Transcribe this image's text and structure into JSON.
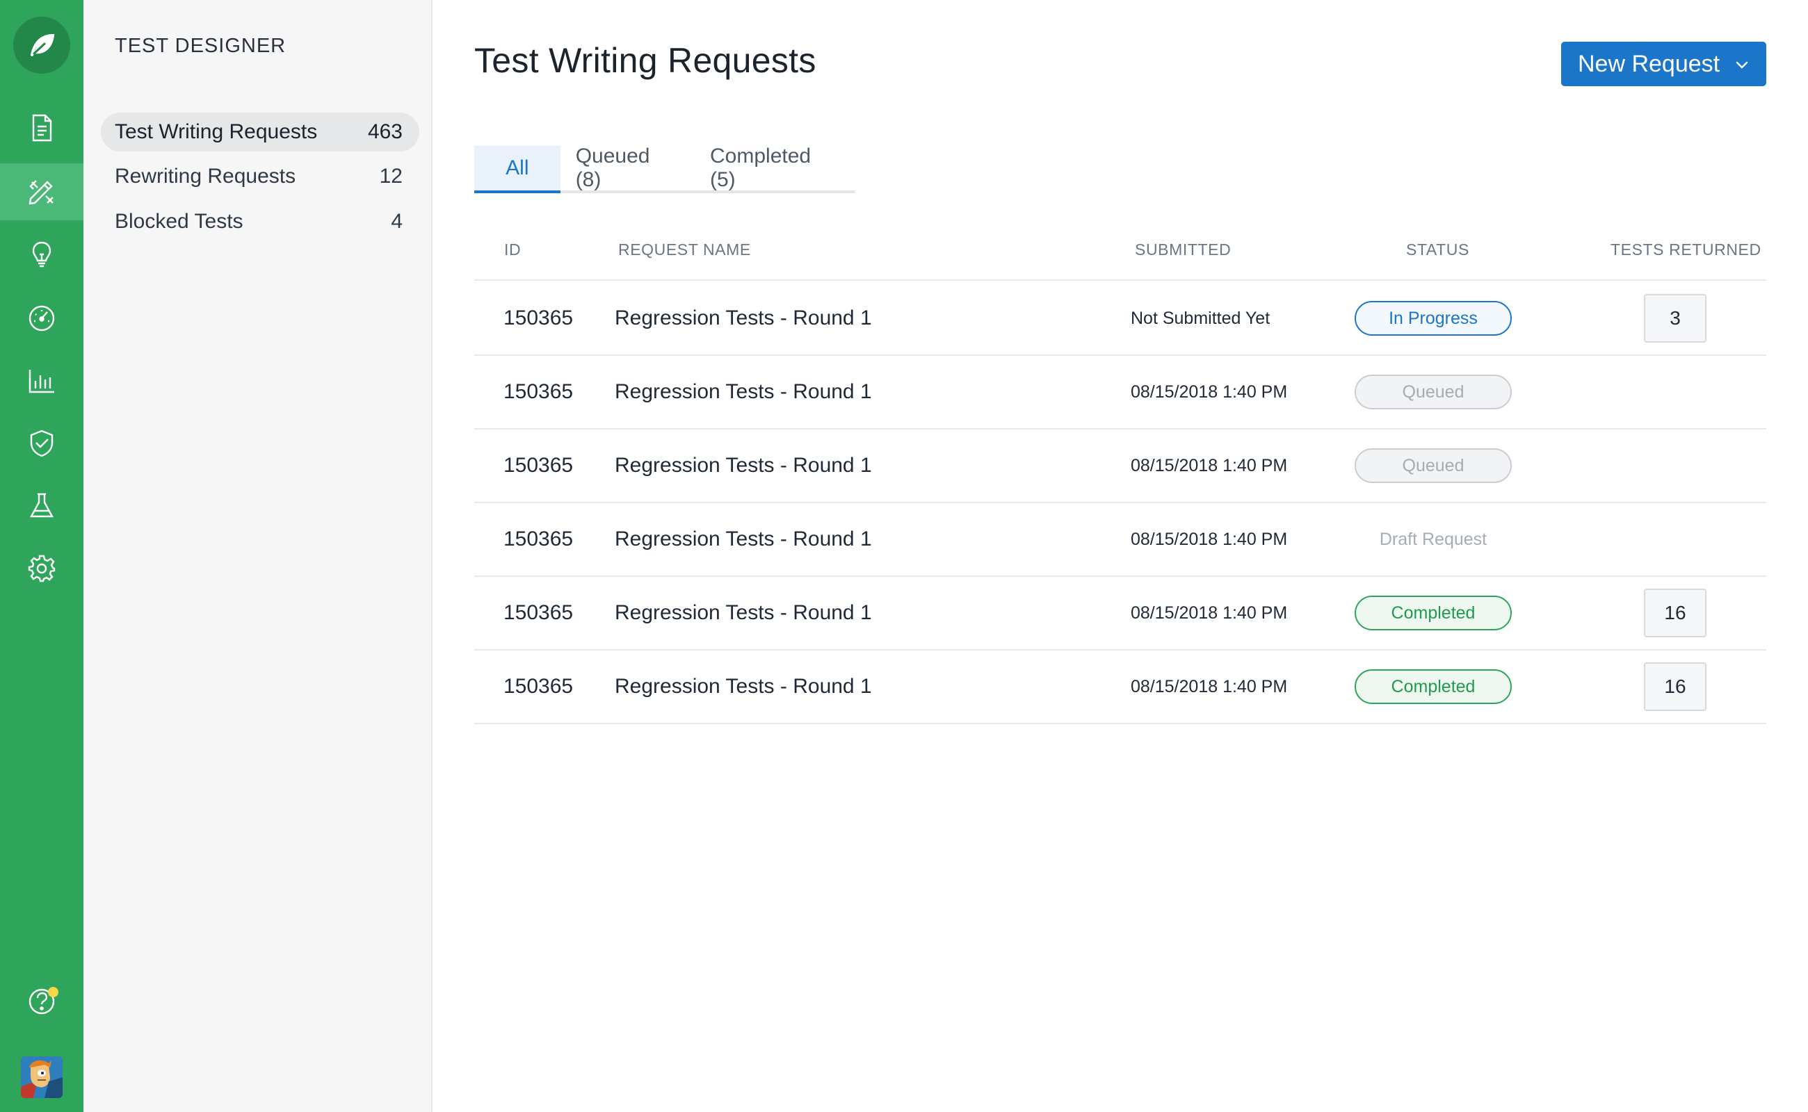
{
  "rail": {
    "logo_icon": "leaf-icon",
    "brand_color": "#2ea55b",
    "items": [
      {
        "icon": "document-icon"
      },
      {
        "icon": "design-tools-icon",
        "active": true
      },
      {
        "icon": "lightbulb-icon"
      },
      {
        "icon": "gauge-icon"
      },
      {
        "icon": "bar-chart-icon"
      },
      {
        "icon": "shield-check-icon"
      },
      {
        "icon": "flask-icon"
      },
      {
        "icon": "settings-icon"
      }
    ],
    "help_icon": "help-icon",
    "notification_color": "#f9d74b"
  },
  "sidebar": {
    "title": "TEST DESIGNER",
    "items": [
      {
        "label": "Test Writing Requests",
        "count": "463",
        "active": true
      },
      {
        "label": "Rewriting Requests",
        "count": "12"
      },
      {
        "label": "Blocked Tests",
        "count": "4"
      }
    ]
  },
  "main": {
    "title": "Test Writing Requests",
    "new_button_label": "New Request",
    "accent_color": "#1b75c8",
    "tabs": [
      {
        "label": "All",
        "active": true
      },
      {
        "label": "Queued (8)"
      },
      {
        "label": "Completed (5)"
      }
    ],
    "columns": {
      "id": "ID",
      "name": "REQUEST NAME",
      "submitted": "SUBMITTED",
      "status": "STATUS",
      "returned": "TESTS RETURNED"
    },
    "rows": [
      {
        "id": "150365",
        "name": "Regression Tests - Round 1",
        "submitted": "Not Submitted Yet",
        "status": "In Progress",
        "status_kind": "progress",
        "returned": "3"
      },
      {
        "id": "150365",
        "name": "Regression Tests - Round 1",
        "submitted": "08/15/2018 1:40 PM",
        "status": "Queued",
        "status_kind": "queued",
        "returned": ""
      },
      {
        "id": "150365",
        "name": "Regression Tests - Round 1",
        "submitted": "08/15/2018 1:40 PM",
        "status": "Queued",
        "status_kind": "queued",
        "returned": ""
      },
      {
        "id": "150365",
        "name": "Regression Tests - Round 1",
        "submitted": "08/15/2018 1:40 PM",
        "status": "Draft Request",
        "status_kind": "draft",
        "returned": ""
      },
      {
        "id": "150365",
        "name": "Regression Tests - Round 1",
        "submitted": "08/15/2018 1:40 PM",
        "status": "Completed",
        "status_kind": "completed",
        "returned": "16"
      },
      {
        "id": "150365",
        "name": "Regression Tests - Round 1",
        "submitted": "08/15/2018 1:40 PM",
        "status": "Completed",
        "status_kind": "completed",
        "returned": "16"
      }
    ]
  }
}
